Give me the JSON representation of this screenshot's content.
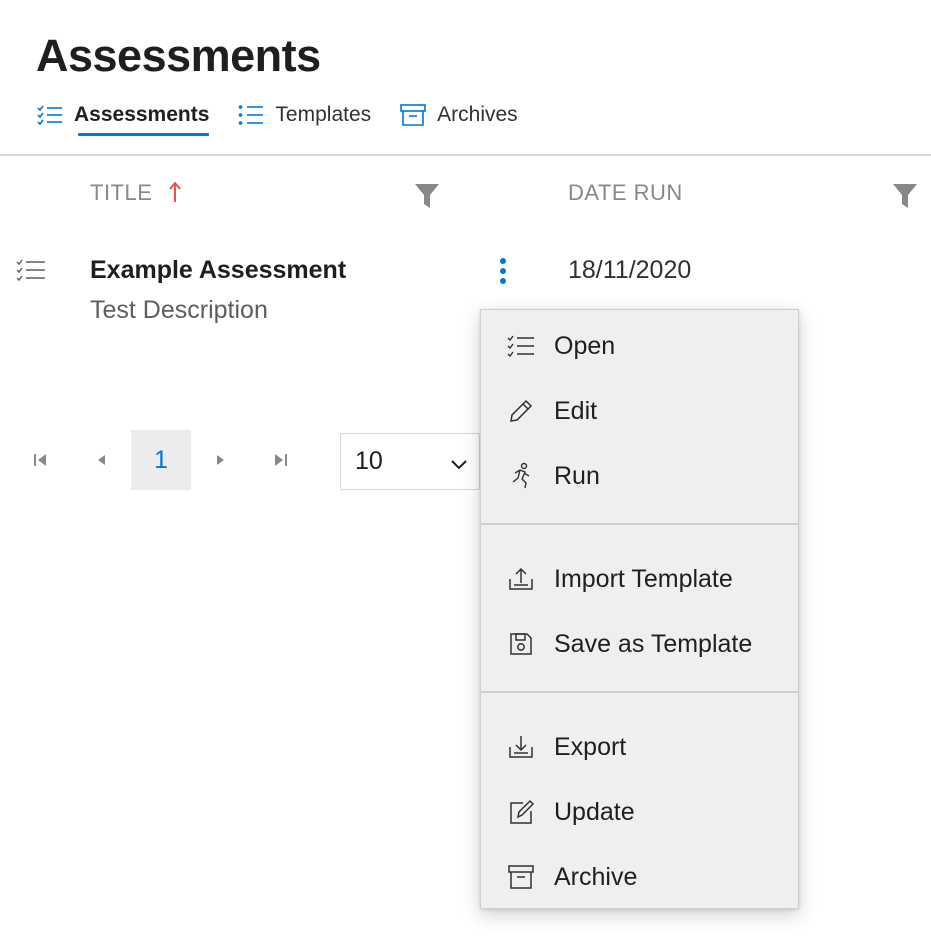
{
  "page": {
    "title": "Assessments"
  },
  "tabs": [
    {
      "label": "Assessments",
      "icon": "checklist-icon",
      "active": true
    },
    {
      "label": "Templates",
      "icon": "bullet-list-icon",
      "active": false
    },
    {
      "label": "Archives",
      "icon": "archive-icon",
      "active": false
    }
  ],
  "table": {
    "columns": [
      {
        "label": "TITLE",
        "sorted": "ascending",
        "filterable": true
      },
      {
        "label": "DATE RUN",
        "filterable": true
      }
    ],
    "rows": [
      {
        "title": "Example Assessment",
        "description": "Test Description",
        "date_run": "18/11/2020"
      }
    ]
  },
  "pagination": {
    "current_page": "1",
    "page_size": "10"
  },
  "context_menu": {
    "items": [
      {
        "label": "Open",
        "icon": "checklist-icon"
      },
      {
        "label": "Edit",
        "icon": "pencil-icon"
      },
      {
        "label": "Run",
        "icon": "running-person-icon"
      },
      {
        "label": "Import Template",
        "icon": "upload-icon"
      },
      {
        "label": "Save as Template",
        "icon": "save-icon"
      },
      {
        "label": "Export",
        "icon": "download-icon"
      },
      {
        "label": "Update",
        "icon": "edit-box-icon"
      },
      {
        "label": "Archive",
        "icon": "archive-icon"
      }
    ]
  },
  "colors": {
    "accent": "#0078d4",
    "sort_arrow": "#e8524a",
    "muted": "#8a8886"
  }
}
